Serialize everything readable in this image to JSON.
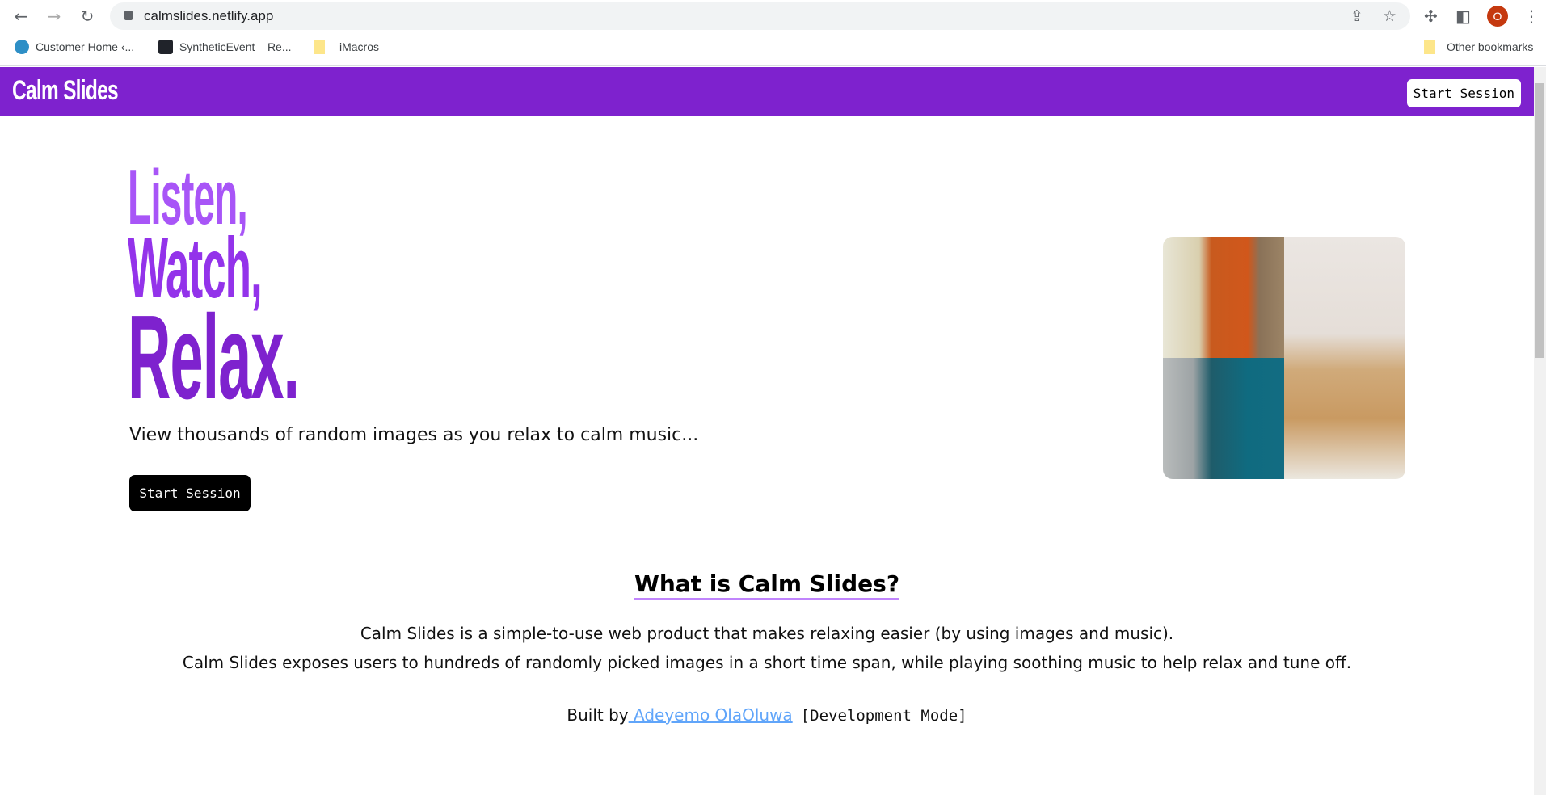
{
  "browser": {
    "url": "calmslides.netlify.app",
    "bookmarks": [
      {
        "label": "Customer Home ‹..."
      },
      {
        "label": "SyntheticEvent – Re..."
      },
      {
        "label": "iMacros"
      }
    ],
    "other_bookmarks": "Other bookmarks",
    "profile_initial": "O"
  },
  "navbar": {
    "brand": "Calm Slides",
    "start_label": "Start Session",
    "color": "#7e22ce"
  },
  "hero": {
    "line1": "Listen,",
    "line2": "Watch,",
    "line3": "Relax.",
    "subtitle": "View thousands of random images as you relax to calm music...",
    "start_label": "Start Session",
    "colors": [
      "#a855f7",
      "#9333ea",
      "#7e22ce"
    ]
  },
  "about": {
    "title": "What is Calm Slides?",
    "para1": "Calm Slides is a simple-to-use web product that makes relaxing easier (by using images and music).",
    "para2": "Calm Slides exposes users to hundreds of randomly picked images in a short time span, while playing soothing music to help relax and tune off.",
    "built_by": "Built by",
    "author": " Adeyemo OlaOluwa",
    "mode": "[Development Mode]"
  }
}
